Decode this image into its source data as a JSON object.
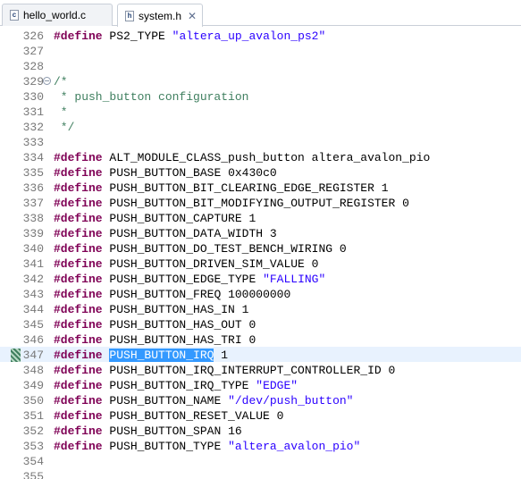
{
  "tabs": [
    {
      "label": "hello_world.c",
      "icon": "c-source-file-icon",
      "icon_glyph": "c",
      "active": false
    },
    {
      "label": "system.h",
      "icon": "header-file-icon",
      "icon_glyph": "h",
      "active": true,
      "close": "✕"
    }
  ],
  "colors": {
    "keyword": "#7f0055",
    "string": "#2a00ff",
    "comment": "#3f7f5f",
    "selection": "#3399ff",
    "current_line": "#e8f2fe"
  },
  "editor": {
    "highlighted_line": "347",
    "selected_text": "PUSH_BUTTON_IRQ",
    "lines": [
      {
        "n": "326",
        "kw": "#define",
        "macro": "PS2_TYPE",
        "value": "\"altera_up_avalon_ps2\"",
        "value_type": "string"
      },
      {
        "n": "327"
      },
      {
        "n": "328"
      },
      {
        "n": "329",
        "comment": "/*",
        "fold": "−"
      },
      {
        "n": "330",
        "comment": " * push_button configuration"
      },
      {
        "n": "331",
        "comment": " *"
      },
      {
        "n": "332",
        "comment": " */"
      },
      {
        "n": "333"
      },
      {
        "n": "334",
        "kw": "#define",
        "macro": "ALT_MODULE_CLASS_push_button",
        "value": "altera_avalon_pio",
        "value_type": "plain"
      },
      {
        "n": "335",
        "kw": "#define",
        "macro": "PUSH_BUTTON_BASE",
        "value": "0x430c0",
        "value_type": "plain"
      },
      {
        "n": "336",
        "kw": "#define",
        "macro": "PUSH_BUTTON_BIT_CLEARING_EDGE_REGISTER",
        "value": "1",
        "value_type": "plain"
      },
      {
        "n": "337",
        "kw": "#define",
        "macro": "PUSH_BUTTON_BIT_MODIFYING_OUTPUT_REGISTER",
        "value": "0",
        "value_type": "plain"
      },
      {
        "n": "338",
        "kw": "#define",
        "macro": "PUSH_BUTTON_CAPTURE",
        "value": "1",
        "value_type": "plain"
      },
      {
        "n": "339",
        "kw": "#define",
        "macro": "PUSH_BUTTON_DATA_WIDTH",
        "value": "3",
        "value_type": "plain"
      },
      {
        "n": "340",
        "kw": "#define",
        "macro": "PUSH_BUTTON_DO_TEST_BENCH_WIRING",
        "value": "0",
        "value_type": "plain"
      },
      {
        "n": "341",
        "kw": "#define",
        "macro": "PUSH_BUTTON_DRIVEN_SIM_VALUE",
        "value": "0",
        "value_type": "plain"
      },
      {
        "n": "342",
        "kw": "#define",
        "macro": "PUSH_BUTTON_EDGE_TYPE",
        "value": "\"FALLING\"",
        "value_type": "string"
      },
      {
        "n": "343",
        "kw": "#define",
        "macro": "PUSH_BUTTON_FREQ",
        "value": "100000000",
        "value_type": "plain"
      },
      {
        "n": "344",
        "kw": "#define",
        "macro": "PUSH_BUTTON_HAS_IN",
        "value": "1",
        "value_type": "plain"
      },
      {
        "n": "345",
        "kw": "#define",
        "macro": "PUSH_BUTTON_HAS_OUT",
        "value": "0",
        "value_type": "plain"
      },
      {
        "n": "346",
        "kw": "#define",
        "macro": "PUSH_BUTTON_HAS_TRI",
        "value": "0",
        "value_type": "plain"
      },
      {
        "n": "347",
        "kw": "#define",
        "macro": "PUSH_BUTTON_IRQ",
        "value": "1",
        "value_type": "plain",
        "selected": true
      },
      {
        "n": "348",
        "kw": "#define",
        "macro": "PUSH_BUTTON_IRQ_INTERRUPT_CONTROLLER_ID",
        "value": "0",
        "value_type": "plain"
      },
      {
        "n": "349",
        "kw": "#define",
        "macro": "PUSH_BUTTON_IRQ_TYPE",
        "value": "\"EDGE\"",
        "value_type": "string"
      },
      {
        "n": "350",
        "kw": "#define",
        "macro": "PUSH_BUTTON_NAME",
        "value": "\"/dev/push_button\"",
        "value_type": "string"
      },
      {
        "n": "351",
        "kw": "#define",
        "macro": "PUSH_BUTTON_RESET_VALUE",
        "value": "0",
        "value_type": "plain"
      },
      {
        "n": "352",
        "kw": "#define",
        "macro": "PUSH_BUTTON_SPAN",
        "value": "16",
        "value_type": "plain"
      },
      {
        "n": "353",
        "kw": "#define",
        "macro": "PUSH_BUTTON_TYPE",
        "value": "\"altera_avalon_pio\"",
        "value_type": "string"
      },
      {
        "n": "354"
      },
      {
        "n": "355"
      }
    ]
  }
}
